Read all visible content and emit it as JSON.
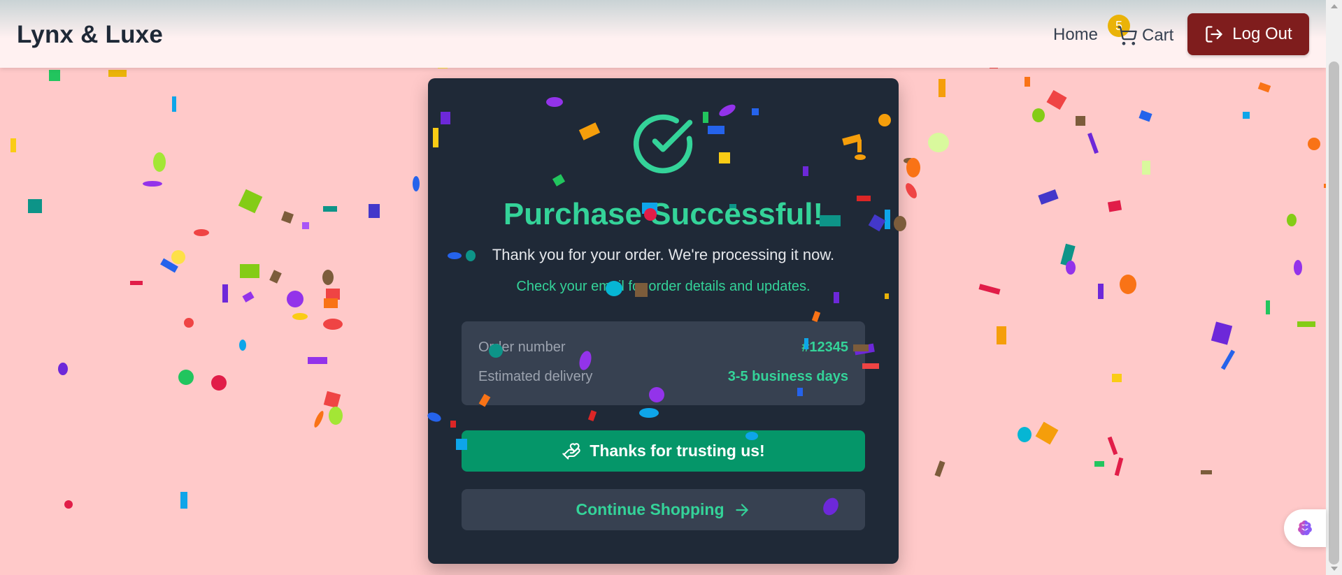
{
  "brand": "Lynx & Luxe",
  "nav": {
    "home_label": "Home",
    "cart_label": "Cart",
    "cart_count": "5",
    "logout_label": "Log Out"
  },
  "success": {
    "title": "Purchase Successful!",
    "subtitle": "Thank you for your order. We're processing it now.",
    "note": "Check your email for order details and updates."
  },
  "order": {
    "number_label": "Order number",
    "number_value": "#12345",
    "delivery_label": "Estimated delivery",
    "delivery_value": "3-5 business days"
  },
  "buttons": {
    "thanks_label": "Thanks for trusting us!",
    "continue_label": "Continue Shopping"
  },
  "colors": {
    "page_bg": "#ffc9c9",
    "card_bg": "#1f2937",
    "accent": "#34d399",
    "primary_button": "#059669",
    "logout": "#7f1d1d",
    "badge": "#eab308"
  },
  "icons": {
    "cart": "shopping-cart-icon",
    "logout": "log-out-icon",
    "success": "check-circle-icon",
    "thanks": "hand-heart-icon",
    "continue": "arrow-right-icon",
    "widget": "brain-icon"
  }
}
